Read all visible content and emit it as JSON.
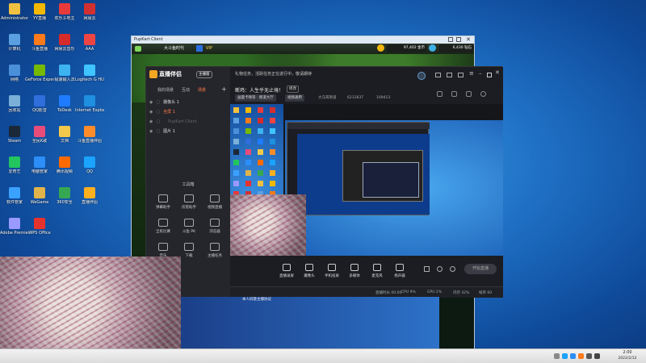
{
  "desktop": {
    "icons": [
      {
        "label": "Administrator",
        "color": "#f0c040"
      },
      {
        "label": "YY直播",
        "color": "#f5b800"
      },
      {
        "label": "欢乐斗地主",
        "color": "#e83a3a"
      },
      {
        "label": "网易云",
        "color": "#d23030"
      },
      {
        "label": "计算机",
        "color": "#5aa0e0"
      },
      {
        "label": "斗鱼直播",
        "color": "#ff7a1a"
      },
      {
        "label": "网易云音乐",
        "color": "#d62b2b"
      },
      {
        "label": "AAA",
        "color": "#ee4444"
      },
      {
        "label": "网络",
        "color": "#4a90d9"
      },
      {
        "label": "GeForce Experience",
        "color": "#76b900"
      },
      {
        "label": "极速输入法",
        "color": "#3db3f0"
      },
      {
        "label": "Logitech G HUB",
        "color": "#40c4ff"
      },
      {
        "label": "回收站",
        "color": "#7ab0d8"
      },
      {
        "label": "QQ影音",
        "color": "#2f6edb"
      },
      {
        "label": "ToDesk",
        "color": "#1f7bff"
      },
      {
        "label": "Internet Explorer",
        "color": "#1f8fe0"
      },
      {
        "label": "Steam",
        "color": "#1b2838"
      },
      {
        "label": "全民K歌",
        "color": "#e84c7a"
      },
      {
        "label": "文档",
        "color": "#f2c94c"
      },
      {
        "label": "斗鱼直播伴侣",
        "color": "#ff8c2a"
      },
      {
        "label": "爱奇艺",
        "color": "#22c55e"
      },
      {
        "label": "电脑管家",
        "color": "#2c8ef8"
      },
      {
        "label": "腾讯视频",
        "color": "#ff6a00"
      },
      {
        "label": "QQ",
        "color": "#1aa3ff"
      },
      {
        "label": "软件管家",
        "color": "#3aa1ff"
      },
      {
        "label": "WeGame",
        "color": "#e0b44a"
      },
      {
        "label": "360安全",
        "color": "#36a852"
      },
      {
        "label": "直播伴侣",
        "color": "#ffb020"
      },
      {
        "label": "Adobe Premiere",
        "color": "#9999ff"
      },
      {
        "label": "WPS Office",
        "color": "#e6322d"
      }
    ]
  },
  "puppet": {
    "title": "PupKart Client",
    "user": "大斗鱼时代",
    "vip": "VIP",
    "coins": "97,402 金币",
    "gems": "6,430 钻石"
  },
  "zhibo": {
    "logo": "直播伴侣",
    "badge": "主播版",
    "notice": "礼物任务，活跃任务正在进行中，敬请期待",
    "room_title": "断鸡：人生乎无止境！",
    "edit": "修改",
    "tags": [
      "画面卡顿等 · 频道大厅",
      "视频通用",
      "大马哥斯道",
      "6212837",
      "109413"
    ],
    "scene_tabs": [
      "我的场景",
      "互动",
      "场景"
    ],
    "sources": [
      {
        "name": "摄像头 1",
        "kind": "camera"
      },
      {
        "name": "全屏 1",
        "kind": "screen"
      },
      {
        "name": "PupKart Client",
        "kind": "window"
      },
      {
        "name": "图片 1",
        "kind": "image"
      }
    ],
    "tools_header": "工具箱",
    "tools": [
      "弹幕助手",
      "房管助手",
      "视频直播",
      "全民比赛",
      "斗鱼 PK",
      "浏览器",
      "音乐",
      "下载",
      "主播任务",
      "主播热榜"
    ],
    "bottom_bar": [
      "直播录屏",
      "摄像头",
      "手机投屏",
      "多媒体",
      "麦克风",
      "扬声器"
    ],
    "start_live": "开始直播",
    "status": [
      "直播时长 00:00",
      "CPU 9%",
      "GPU 2%",
      "内存 42%",
      "帧率 60"
    ],
    "live_tip": "本人同意主播协议"
  },
  "taskbar": {
    "clock_time": "2:00",
    "clock_date": "2022/2/12"
  }
}
